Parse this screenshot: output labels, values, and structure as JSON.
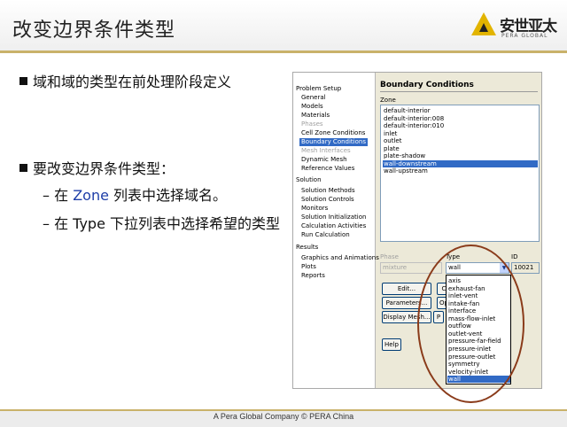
{
  "slide": {
    "title": "改变边界条件类型",
    "logo_text": "安世亚太",
    "logo_sub": "PERA GLOBAL",
    "footer": "A Pera Global Company ©  PERA China"
  },
  "bullets": {
    "b1": "域和域的类型在前处理阶段定义",
    "b2": "要改变边界条件类型：",
    "s1_pre": "– 在 ",
    "s1_hl": "Zone",
    "s1_post": " 列表中选择域名。",
    "s2": "– 在 Type 下拉列表中选择希望的类型"
  },
  "tree": {
    "problem_setup": "Problem Setup",
    "general": "General",
    "models": "Models",
    "materials": "Materials",
    "phases": "Phases",
    "cell_zone": "Cell Zone Conditions",
    "boundary": "Boundary Conditions",
    "mesh_interfaces": "Mesh Interfaces",
    "dynamic_mesh": "Dynamic Mesh",
    "reference_values": "Reference Values",
    "solution": "Solution",
    "solution_methods": "Solution Methods",
    "solution_controls": "Solution Controls",
    "monitors": "Monitors",
    "solution_init": "Solution Initialization",
    "calc_activities": "Calculation Activities",
    "run_calc": "Run Calculation",
    "results": "Results",
    "graphics": "Graphics and Animations",
    "plots": "Plots",
    "reports": "Reports"
  },
  "bc": {
    "title": "Boundary Conditions",
    "zone_label": "Zone",
    "zones": [
      "default-interior",
      "default-interior:008",
      "default-interior:010",
      "inlet",
      "outlet",
      "plate",
      "plate-shadow",
      "wall-downstream",
      "wall-upstream"
    ],
    "selected_zone": "wall-downstream",
    "phase_label": "Phase",
    "phase_value": "mixture",
    "type_label": "Type",
    "type_value": "wall",
    "id_label": "ID",
    "id_value": "10021",
    "edit_btn": "Edit...",
    "copy_btn": "C",
    "params_btn": "Parameters...",
    "op_btn": "Op",
    "display_mesh_btn": "Display Mesh...",
    "p_btn": "P",
    "help_btn": "Help",
    "type_options": [
      "axis",
      "exhaust-fan",
      "inlet-vent",
      "intake-fan",
      "interface",
      "mass-flow-inlet",
      "outflow",
      "outlet-vent",
      "pressure-far-field",
      "pressure-inlet",
      "pressure-outlet",
      "symmetry",
      "velocity-inlet",
      "wall"
    ],
    "selected_type": "wall"
  },
  "colors": {
    "selection": "#316ac5",
    "accent_rule": "#c9b26a",
    "highlight_text": "#1e3ea8",
    "oval": "#8a3b1a"
  }
}
